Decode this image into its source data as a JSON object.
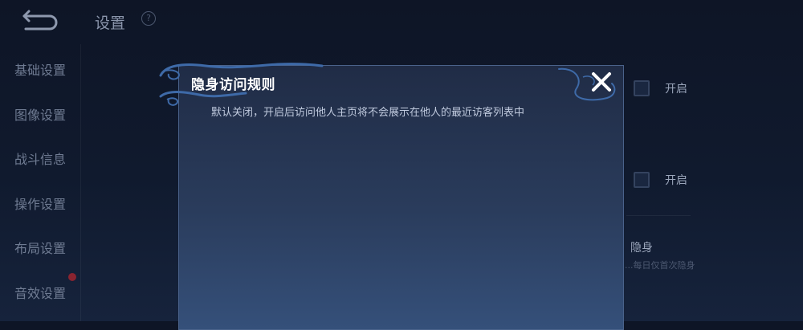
{
  "header": {
    "title": "设置",
    "back_icon": "back-arrow-icon",
    "help_icon": "question-icon",
    "help_glyph": "?"
  },
  "sidebar": {
    "items": [
      {
        "label": "基础设置"
      },
      {
        "label": "图像设置"
      },
      {
        "label": "战斗信息"
      },
      {
        "label": "操作设置"
      },
      {
        "label": "布局设置"
      },
      {
        "label": "音效设置"
      }
    ],
    "badge_color": "#8a2430"
  },
  "settings": {
    "toggle_1_label": "开启",
    "toggle_2_label": "开启",
    "section_label": "隐身",
    "section_sub": "...每日仅首次隐身"
  },
  "modal": {
    "title": "隐身访问规则",
    "description": "默认关闭，开启后访问他人主页将不会展示在他人的最近访客列表中",
    "close_icon": "close-x-icon"
  },
  "colors": {
    "background": "#0e1526",
    "modal_top": "#202c46",
    "modal_bottom": "#35507a",
    "modal_border": "#4a628a",
    "close_icon": "#ffffff"
  }
}
